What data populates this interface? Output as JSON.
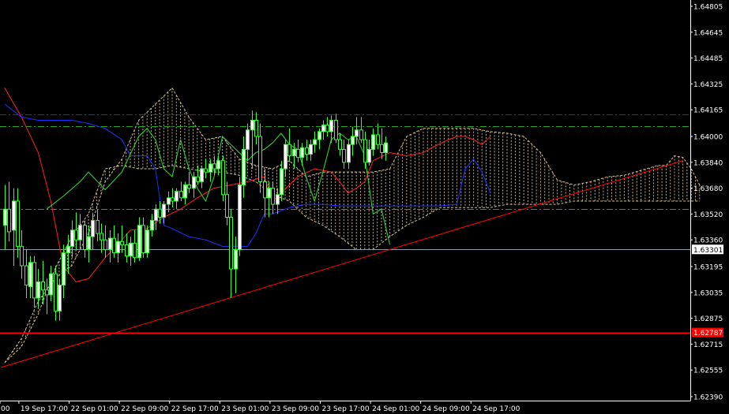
{
  "chart_data": {
    "type": "candlestick",
    "symbol_hidden": true,
    "y_axis": {
      "min": 1.6237,
      "max": 1.6483,
      "tick_labels": [
        "1.64805",
        "1.64645",
        "1.64485",
        "1.64325",
        "1.64165",
        "1.64000",
        "1.63840",
        "1.63680",
        "1.63520",
        "1.63360",
        "1.63195",
        "1.63035",
        "1.62875",
        "1.62715",
        "1.62555",
        "1.62390"
      ],
      "tick_values": [
        1.64805,
        1.64645,
        1.64485,
        1.64325,
        1.64165,
        1.64,
        1.6384,
        1.6368,
        1.6352,
        1.6336,
        1.63195,
        1.63035,
        1.62875,
        1.62715,
        1.62555,
        1.6239
      ]
    },
    "x_axis": {
      "tick_labels": [
        "00",
        "19 Sep 17:00",
        "22 Sep 01:00",
        "22 Sep 09:00",
        "22 Sep 17:00",
        "23 Sep 01:00",
        "23 Sep 09:00",
        "23 Sep 17:00",
        "24 Sep 01:00",
        "24 Sep 09:00",
        "24 Sep 17:00"
      ],
      "tick_bar_index": [
        0,
        3,
        15,
        27,
        39,
        51,
        63,
        75,
        87,
        99,
        111
      ]
    },
    "price_labels": [
      {
        "text": "1.63301",
        "value": 1.63301,
        "bg": "#ffffff",
        "fg": "#000000"
      },
      {
        "text": "1.62787",
        "value": 1.62787,
        "bg": "#ff0000",
        "fg": "#ffffff"
      }
    ],
    "horizontal_levels": [
      {
        "value": 1.64135,
        "color": "#cc0000",
        "style": "dashdot"
      },
      {
        "value": 1.64065,
        "color": "#22aa22",
        "style": "dashdot"
      },
      {
        "value": 1.6355,
        "color": "#22aa22",
        "style": "dashdot"
      },
      {
        "value": 1.62787,
        "color": "#ff0000",
        "style": "solid"
      },
      {
        "value": 1.63301,
        "color": "#8899aa",
        "style": "solid"
      }
    ],
    "trendline": {
      "color": "#ff0000",
      "from": {
        "bar": -1,
        "value": 1.6257
      },
      "to": {
        "bar": 162,
        "value": 1.6385
      }
    },
    "colors": {
      "bull": "#ffffff",
      "bear": "#000000",
      "wick": "#33ff33",
      "tenkan": "#ff2020",
      "kijun": "#2030ff",
      "chikou": "#33dd33",
      "cloud": "#d8c090"
    },
    "candles": [
      [
        1.6345,
        1.637,
        1.633,
        1.6355
      ],
      [
        1.6355,
        1.6372,
        1.6335,
        1.6341
      ],
      [
        1.6342,
        1.6368,
        1.632,
        1.636
      ],
      [
        1.636,
        1.6368,
        1.6325,
        1.6332
      ],
      [
        1.6332,
        1.6342,
        1.6312,
        1.632
      ],
      [
        1.632,
        1.633,
        1.63,
        1.6308
      ],
      [
        1.6307,
        1.6326,
        1.63,
        1.6322
      ],
      [
        1.6322,
        1.6326,
        1.6294,
        1.63
      ],
      [
        1.63,
        1.6318,
        1.6294,
        1.631
      ],
      [
        1.631,
        1.6323,
        1.6296,
        1.6305
      ],
      [
        1.6305,
        1.6312,
        1.629,
        1.6302
      ],
      [
        1.6302,
        1.632,
        1.6298,
        1.6315
      ],
      [
        1.6315,
        1.632,
        1.6286,
        1.6292
      ],
      [
        1.6292,
        1.6312,
        1.6286,
        1.6308
      ],
      [
        1.6308,
        1.6333,
        1.63,
        1.6328
      ],
      [
        1.6328,
        1.6339,
        1.6315,
        1.6332
      ],
      [
        1.6332,
        1.6348,
        1.6325,
        1.6342
      ],
      [
        1.6342,
        1.6353,
        1.633,
        1.6336
      ],
      [
        1.6336,
        1.6352,
        1.633,
        1.6345
      ],
      [
        1.6345,
        1.6348,
        1.6325,
        1.633
      ],
      [
        1.633,
        1.6345,
        1.6322,
        1.6338
      ],
      [
        1.6338,
        1.6352,
        1.633,
        1.6348
      ],
      [
        1.6348,
        1.6355,
        1.6335,
        1.634
      ],
      [
        1.634,
        1.6346,
        1.6328,
        1.6336
      ],
      [
        1.6336,
        1.6345,
        1.6325,
        1.633
      ],
      [
        1.633,
        1.6342,
        1.6322,
        1.6337
      ],
      [
        1.6337,
        1.6345,
        1.6325,
        1.6328
      ],
      [
        1.6328,
        1.634,
        1.6322,
        1.6335
      ],
      [
        1.6335,
        1.6345,
        1.6328,
        1.6333
      ],
      [
        1.6333,
        1.634,
        1.6322,
        1.6326
      ],
      [
        1.6326,
        1.6338,
        1.632,
        1.6334
      ],
      [
        1.6334,
        1.6342,
        1.6322,
        1.6325
      ],
      [
        1.6325,
        1.635,
        1.6323,
        1.6345
      ],
      [
        1.6345,
        1.635,
        1.6325,
        1.6328
      ],
      [
        1.6328,
        1.6345,
        1.6325,
        1.6342
      ],
      [
        1.6342,
        1.6352,
        1.6338,
        1.6348
      ],
      [
        1.6348,
        1.6358,
        1.6342,
        1.6355
      ],
      [
        1.6355,
        1.636,
        1.6346,
        1.635
      ],
      [
        1.635,
        1.636,
        1.6346,
        1.6358
      ],
      [
        1.6358,
        1.6366,
        1.6353,
        1.6362
      ],
      [
        1.6362,
        1.6368,
        1.6356,
        1.636
      ],
      [
        1.636,
        1.6368,
        1.6355,
        1.6366
      ],
      [
        1.6366,
        1.6372,
        1.636,
        1.6362
      ],
      [
        1.6362,
        1.6372,
        1.6358,
        1.637
      ],
      [
        1.637,
        1.6378,
        1.6365,
        1.6368
      ],
      [
        1.6368,
        1.6378,
        1.6362,
        1.6375
      ],
      [
        1.6375,
        1.6382,
        1.637,
        1.6372
      ],
      [
        1.6372,
        1.6382,
        1.6368,
        1.638
      ],
      [
        1.638,
        1.6386,
        1.6374,
        1.6378
      ],
      [
        1.6378,
        1.6386,
        1.6372,
        1.6383
      ],
      [
        1.6383,
        1.6388,
        1.6376,
        1.638
      ],
      [
        1.638,
        1.6388,
        1.6376,
        1.6385
      ],
      [
        1.6385,
        1.6388,
        1.636,
        1.6364
      ],
      [
        1.6364,
        1.6372,
        1.6345,
        1.635
      ],
      [
        1.635,
        1.6355,
        1.63,
        1.6318
      ],
      [
        1.6318,
        1.6338,
        1.6303,
        1.633
      ],
      [
        1.633,
        1.6375,
        1.6326,
        1.637
      ],
      [
        1.637,
        1.64,
        1.6362,
        1.6392
      ],
      [
        1.6392,
        1.6408,
        1.6385,
        1.6404
      ],
      [
        1.6404,
        1.6416,
        1.638,
        1.641
      ],
      [
        1.641,
        1.6415,
        1.6395,
        1.64
      ],
      [
        1.64,
        1.6408,
        1.6365,
        1.6372
      ],
      [
        1.6372,
        1.638,
        1.635,
        1.6362
      ],
      [
        1.6362,
        1.6372,
        1.635,
        1.6368
      ],
      [
        1.6368,
        1.6372,
        1.6352,
        1.6358
      ],
      [
        1.6358,
        1.6368,
        1.6352,
        1.6364
      ],
      [
        1.6364,
        1.6385,
        1.636,
        1.638
      ],
      [
        1.638,
        1.6398,
        1.6375,
        1.6395
      ],
      [
        1.6395,
        1.6405,
        1.6385,
        1.6388
      ],
      [
        1.6388,
        1.6396,
        1.638,
        1.6392
      ],
      [
        1.6392,
        1.6398,
        1.6384,
        1.6387
      ],
      [
        1.6387,
        1.6396,
        1.6382,
        1.6393
      ],
      [
        1.6393,
        1.6398,
        1.6385,
        1.6389
      ],
      [
        1.6389,
        1.6398,
        1.6385,
        1.6395
      ],
      [
        1.6395,
        1.6403,
        1.639,
        1.6398
      ],
      [
        1.6398,
        1.6405,
        1.6392,
        1.6403
      ],
      [
        1.6403,
        1.641,
        1.6398,
        1.6407
      ],
      [
        1.6407,
        1.6412,
        1.64,
        1.6403
      ],
      [
        1.6403,
        1.6413,
        1.6396,
        1.641
      ],
      [
        1.641,
        1.6414,
        1.6396,
        1.6398
      ],
      [
        1.6398,
        1.6402,
        1.6388,
        1.6392
      ],
      [
        1.6392,
        1.6398,
        1.638,
        1.6384
      ],
      [
        1.6384,
        1.6398,
        1.638,
        1.6395
      ],
      [
        1.6395,
        1.6406,
        1.6388,
        1.64
      ],
      [
        1.64,
        1.6412,
        1.6395,
        1.6404
      ],
      [
        1.6404,
        1.6412,
        1.6396,
        1.6398
      ],
      [
        1.6398,
        1.6403,
        1.638,
        1.6384
      ],
      [
        1.6384,
        1.6398,
        1.6382,
        1.6392
      ],
      [
        1.6392,
        1.6405,
        1.6388,
        1.6401
      ],
      [
        1.6401,
        1.6408,
        1.6392,
        1.6395
      ],
      [
        1.6395,
        1.6405,
        1.6386,
        1.639
      ],
      [
        1.639,
        1.64,
        1.6385,
        1.6396
      ]
    ],
    "tenkan": [
      [
        0,
        1.643
      ],
      [
        4,
        1.6412
      ],
      [
        8,
        1.639
      ],
      [
        11,
        1.636
      ],
      [
        14,
        1.632
      ],
      [
        17,
        1.631
      ],
      [
        20,
        1.6312
      ],
      [
        24,
        1.6325
      ],
      [
        27,
        1.6333
      ],
      [
        30,
        1.6342
      ],
      [
        34,
        1.6343
      ],
      [
        38,
        1.635
      ],
      [
        42,
        1.6355
      ],
      [
        46,
        1.6362
      ],
      [
        50,
        1.6368
      ],
      [
        54,
        1.637
      ],
      [
        58,
        1.6372
      ],
      [
        62,
        1.6375
      ],
      [
        64,
        1.636
      ],
      [
        66,
        1.6365
      ],
      [
        68,
        1.637
      ],
      [
        70,
        1.6375
      ],
      [
        74,
        1.638
      ],
      [
        78,
        1.6378
      ],
      [
        80,
        1.6372
      ],
      [
        82,
        1.6365
      ],
      [
        84,
        1.6368
      ],
      [
        86,
        1.6372
      ],
      [
        88,
        1.6385
      ],
      [
        92,
        1.639
      ],
      [
        96,
        1.6388
      ],
      [
        100,
        1.639
      ],
      [
        102,
        1.6393
      ],
      [
        106,
        1.6398
      ],
      [
        108,
        1.64
      ],
      [
        110,
        1.64
      ],
      [
        112,
        1.6398
      ],
      [
        114,
        1.6395
      ],
      [
        116,
        1.64
      ]
    ],
    "kijun": [
      [
        0,
        1.642
      ],
      [
        4,
        1.6412
      ],
      [
        8,
        1.641
      ],
      [
        12,
        1.641
      ],
      [
        16,
        1.641
      ],
      [
        20,
        1.6408
      ],
      [
        24,
        1.6405
      ],
      [
        28,
        1.6398
      ],
      [
        30,
        1.6388
      ],
      [
        34,
        1.6388
      ],
      [
        36,
        1.638
      ],
      [
        38,
        1.6345
      ],
      [
        40,
        1.6343
      ],
      [
        44,
        1.6338
      ],
      [
        48,
        1.6336
      ],
      [
        52,
        1.6332
      ],
      [
        54,
        1.6332
      ],
      [
        56,
        1.6332
      ],
      [
        58,
        1.6332
      ],
      [
        60,
        1.634
      ],
      [
        62,
        1.6352
      ],
      [
        64,
        1.6352
      ],
      [
        68,
        1.6356
      ],
      [
        72,
        1.6358
      ],
      [
        76,
        1.6358
      ],
      [
        80,
        1.6357
      ],
      [
        84,
        1.6357
      ],
      [
        88,
        1.6357
      ],
      [
        92,
        1.6357
      ],
      [
        96,
        1.6357
      ],
      [
        100,
        1.6357
      ],
      [
        104,
        1.6357
      ],
      [
        108,
        1.6358
      ],
      [
        110,
        1.638
      ],
      [
        112,
        1.6386
      ],
      [
        114,
        1.6378
      ],
      [
        116,
        1.6365
      ]
    ],
    "chikou": [
      [
        10,
        1.6355
      ],
      [
        14,
        1.6363
      ],
      [
        18,
        1.6372
      ],
      [
        20,
        1.6378
      ],
      [
        24,
        1.6367
      ],
      [
        28,
        1.6378
      ],
      [
        32,
        1.64
      ],
      [
        34,
        1.6405
      ],
      [
        36,
        1.6398
      ],
      [
        38,
        1.638
      ],
      [
        40,
        1.6375
      ],
      [
        42,
        1.6398
      ],
      [
        44,
        1.638
      ],
      [
        46,
        1.6368
      ],
      [
        48,
        1.636
      ],
      [
        50,
        1.6375
      ],
      [
        52,
        1.64
      ],
      [
        54,
        1.6395
      ],
      [
        56,
        1.639
      ],
      [
        58,
        1.6385
      ],
      [
        60,
        1.639
      ],
      [
        62,
        1.6392
      ],
      [
        64,
        1.6396
      ],
      [
        66,
        1.6402
      ],
      [
        68,
        1.6395
      ],
      [
        70,
        1.6392
      ],
      [
        72,
        1.6375
      ],
      [
        74,
        1.636
      ],
      [
        76,
        1.6378
      ],
      [
        78,
        1.6398
      ],
      [
        80,
        1.6402
      ],
      [
        82,
        1.6398
      ],
      [
        84,
        1.64
      ],
      [
        86,
        1.6388
      ],
      [
        88,
        1.6352
      ],
      [
        90,
        1.6355
      ],
      [
        92,
        1.6333
      ]
    ],
    "cloud_a": [
      [
        0,
        1.626
      ],
      [
        4,
        1.6275
      ],
      [
        8,
        1.6298
      ],
      [
        12,
        1.6312
      ],
      [
        16,
        1.632
      ],
      [
        20,
        1.634
      ],
      [
        24,
        1.6372
      ],
      [
        28,
        1.6386
      ],
      [
        32,
        1.641
      ],
      [
        36,
        1.642
      ],
      [
        40,
        1.643
      ],
      [
        44,
        1.6412
      ],
      [
        48,
        1.6398
      ],
      [
        52,
        1.64
      ],
      [
        56,
        1.6386
      ],
      [
        60,
        1.6382
      ],
      [
        64,
        1.638
      ],
      [
        68,
        1.6385
      ],
      [
        72,
        1.6375
      ],
      [
        76,
        1.6378
      ],
      [
        80,
        1.6378
      ],
      [
        84,
        1.6378
      ],
      [
        88,
        1.6378
      ],
      [
        92,
        1.638
      ],
      [
        96,
        1.64
      ],
      [
        100,
        1.6405
      ],
      [
        104,
        1.6405
      ],
      [
        108,
        1.6405
      ],
      [
        112,
        1.6405
      ],
      [
        116,
        1.6403
      ],
      [
        120,
        1.6402
      ],
      [
        124,
        1.64
      ],
      [
        128,
        1.639
      ],
      [
        132,
        1.6373
      ],
      [
        136,
        1.637
      ],
      [
        140,
        1.6372
      ],
      [
        144,
        1.6375
      ],
      [
        148,
        1.6376
      ],
      [
        152,
        1.6379
      ],
      [
        156,
        1.6382
      ],
      [
        158,
        1.6382
      ],
      [
        160,
        1.6388
      ],
      [
        162,
        1.6387
      ],
      [
        164,
        1.638
      ],
      [
        166,
        1.637
      ]
    ],
    "cloud_b": [
      [
        0,
        1.626
      ],
      [
        4,
        1.627
      ],
      [
        8,
        1.629
      ],
      [
        12,
        1.6318
      ],
      [
        16,
        1.6338
      ],
      [
        20,
        1.6352
      ],
      [
        24,
        1.638
      ],
      [
        28,
        1.6382
      ],
      [
        32,
        1.638
      ],
      [
        36,
        1.638
      ],
      [
        40,
        1.6382
      ],
      [
        44,
        1.638
      ],
      [
        48,
        1.6378
      ],
      [
        52,
        1.6378
      ],
      [
        56,
        1.6376
      ],
      [
        60,
        1.6372
      ],
      [
        64,
        1.6364
      ],
      [
        68,
        1.636
      ],
      [
        72,
        1.635
      ],
      [
        76,
        1.6345
      ],
      [
        80,
        1.6338
      ],
      [
        84,
        1.633
      ],
      [
        88,
        1.633
      ],
      [
        92,
        1.6338
      ],
      [
        96,
        1.6345
      ],
      [
        100,
        1.635
      ],
      [
        104,
        1.6356
      ],
      [
        108,
        1.6356
      ],
      [
        112,
        1.6356
      ],
      [
        116,
        1.6356
      ],
      [
        120,
        1.6358
      ],
      [
        124,
        1.6358
      ],
      [
        128,
        1.6358
      ],
      [
        132,
        1.6358
      ],
      [
        136,
        1.636
      ],
      [
        140,
        1.636
      ],
      [
        144,
        1.636
      ],
      [
        148,
        1.636
      ],
      [
        152,
        1.636
      ],
      [
        156,
        1.636
      ],
      [
        160,
        1.636
      ],
      [
        164,
        1.636
      ],
      [
        166,
        1.636
      ]
    ]
  }
}
